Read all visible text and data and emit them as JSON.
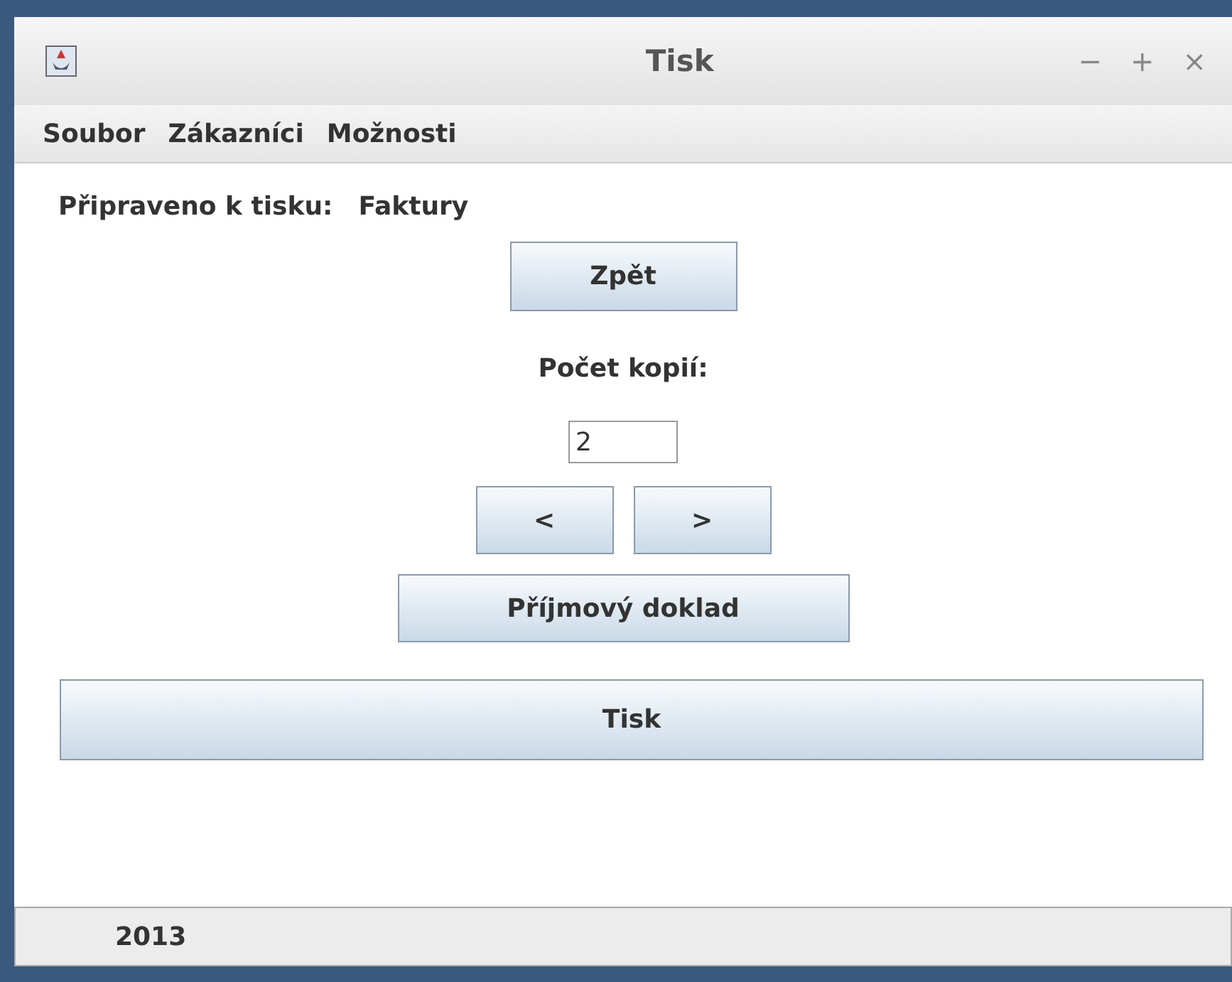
{
  "window": {
    "title": "Tisk",
    "controls": [
      "−",
      "+",
      "×"
    ]
  },
  "menu": [
    "Soubor",
    "Zákazníci",
    "Možnosti"
  ],
  "ready": {
    "label": "Připraveno k tisku:",
    "value": "Faktury"
  },
  "back_button": "Zpět",
  "copies": {
    "label": "Počet kopií:",
    "value": "2"
  },
  "nav_buttons": [
    "<",
    ">"
  ],
  "receipt_button": "Příjmový doklad",
  "print_button": "Tisk",
  "status_bar": "2013"
}
